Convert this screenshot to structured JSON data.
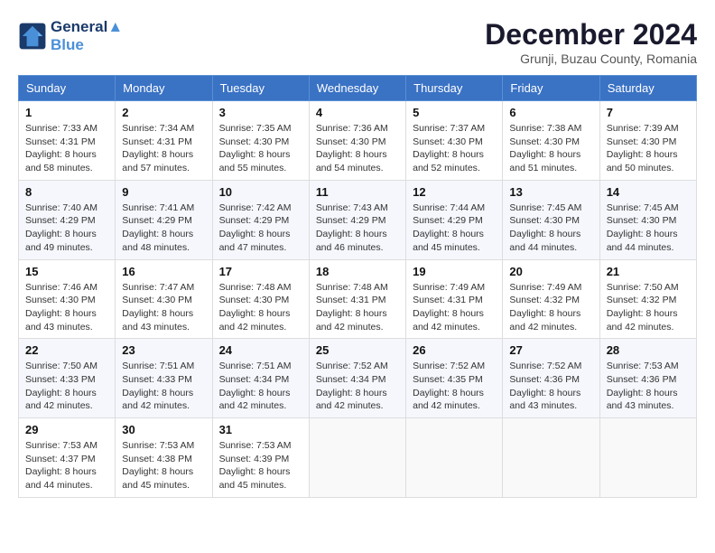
{
  "logo": {
    "line1": "General",
    "line2": "Blue"
  },
  "title": "December 2024",
  "subtitle": "Grunji, Buzau County, Romania",
  "days_header": [
    "Sunday",
    "Monday",
    "Tuesday",
    "Wednesday",
    "Thursday",
    "Friday",
    "Saturday"
  ],
  "weeks": [
    [
      {
        "day": "1",
        "sunrise": "7:33 AM",
        "sunset": "4:31 PM",
        "daylight": "8 hours and 58 minutes."
      },
      {
        "day": "2",
        "sunrise": "7:34 AM",
        "sunset": "4:31 PM",
        "daylight": "8 hours and 57 minutes."
      },
      {
        "day": "3",
        "sunrise": "7:35 AM",
        "sunset": "4:30 PM",
        "daylight": "8 hours and 55 minutes."
      },
      {
        "day": "4",
        "sunrise": "7:36 AM",
        "sunset": "4:30 PM",
        "daylight": "8 hours and 54 minutes."
      },
      {
        "day": "5",
        "sunrise": "7:37 AM",
        "sunset": "4:30 PM",
        "daylight": "8 hours and 52 minutes."
      },
      {
        "day": "6",
        "sunrise": "7:38 AM",
        "sunset": "4:30 PM",
        "daylight": "8 hours and 51 minutes."
      },
      {
        "day": "7",
        "sunrise": "7:39 AM",
        "sunset": "4:30 PM",
        "daylight": "8 hours and 50 minutes."
      }
    ],
    [
      {
        "day": "8",
        "sunrise": "7:40 AM",
        "sunset": "4:29 PM",
        "daylight": "8 hours and 49 minutes."
      },
      {
        "day": "9",
        "sunrise": "7:41 AM",
        "sunset": "4:29 PM",
        "daylight": "8 hours and 48 minutes."
      },
      {
        "day": "10",
        "sunrise": "7:42 AM",
        "sunset": "4:29 PM",
        "daylight": "8 hours and 47 minutes."
      },
      {
        "day": "11",
        "sunrise": "7:43 AM",
        "sunset": "4:29 PM",
        "daylight": "8 hours and 46 minutes."
      },
      {
        "day": "12",
        "sunrise": "7:44 AM",
        "sunset": "4:29 PM",
        "daylight": "8 hours and 45 minutes."
      },
      {
        "day": "13",
        "sunrise": "7:45 AM",
        "sunset": "4:30 PM",
        "daylight": "8 hours and 44 minutes."
      },
      {
        "day": "14",
        "sunrise": "7:45 AM",
        "sunset": "4:30 PM",
        "daylight": "8 hours and 44 minutes."
      }
    ],
    [
      {
        "day": "15",
        "sunrise": "7:46 AM",
        "sunset": "4:30 PM",
        "daylight": "8 hours and 43 minutes."
      },
      {
        "day": "16",
        "sunrise": "7:47 AM",
        "sunset": "4:30 PM",
        "daylight": "8 hours and 43 minutes."
      },
      {
        "day": "17",
        "sunrise": "7:48 AM",
        "sunset": "4:30 PM",
        "daylight": "8 hours and 42 minutes."
      },
      {
        "day": "18",
        "sunrise": "7:48 AM",
        "sunset": "4:31 PM",
        "daylight": "8 hours and 42 minutes."
      },
      {
        "day": "19",
        "sunrise": "7:49 AM",
        "sunset": "4:31 PM",
        "daylight": "8 hours and 42 minutes."
      },
      {
        "day": "20",
        "sunrise": "7:49 AM",
        "sunset": "4:32 PM",
        "daylight": "8 hours and 42 minutes."
      },
      {
        "day": "21",
        "sunrise": "7:50 AM",
        "sunset": "4:32 PM",
        "daylight": "8 hours and 42 minutes."
      }
    ],
    [
      {
        "day": "22",
        "sunrise": "7:50 AM",
        "sunset": "4:33 PM",
        "daylight": "8 hours and 42 minutes."
      },
      {
        "day": "23",
        "sunrise": "7:51 AM",
        "sunset": "4:33 PM",
        "daylight": "8 hours and 42 minutes."
      },
      {
        "day": "24",
        "sunrise": "7:51 AM",
        "sunset": "4:34 PM",
        "daylight": "8 hours and 42 minutes."
      },
      {
        "day": "25",
        "sunrise": "7:52 AM",
        "sunset": "4:34 PM",
        "daylight": "8 hours and 42 minutes."
      },
      {
        "day": "26",
        "sunrise": "7:52 AM",
        "sunset": "4:35 PM",
        "daylight": "8 hours and 42 minutes."
      },
      {
        "day": "27",
        "sunrise": "7:52 AM",
        "sunset": "4:36 PM",
        "daylight": "8 hours and 43 minutes."
      },
      {
        "day": "28",
        "sunrise": "7:53 AM",
        "sunset": "4:36 PM",
        "daylight": "8 hours and 43 minutes."
      }
    ],
    [
      {
        "day": "29",
        "sunrise": "7:53 AM",
        "sunset": "4:37 PM",
        "daylight": "8 hours and 44 minutes."
      },
      {
        "day": "30",
        "sunrise": "7:53 AM",
        "sunset": "4:38 PM",
        "daylight": "8 hours and 45 minutes."
      },
      {
        "day": "31",
        "sunrise": "7:53 AM",
        "sunset": "4:39 PM",
        "daylight": "8 hours and 45 minutes."
      },
      null,
      null,
      null,
      null
    ]
  ]
}
